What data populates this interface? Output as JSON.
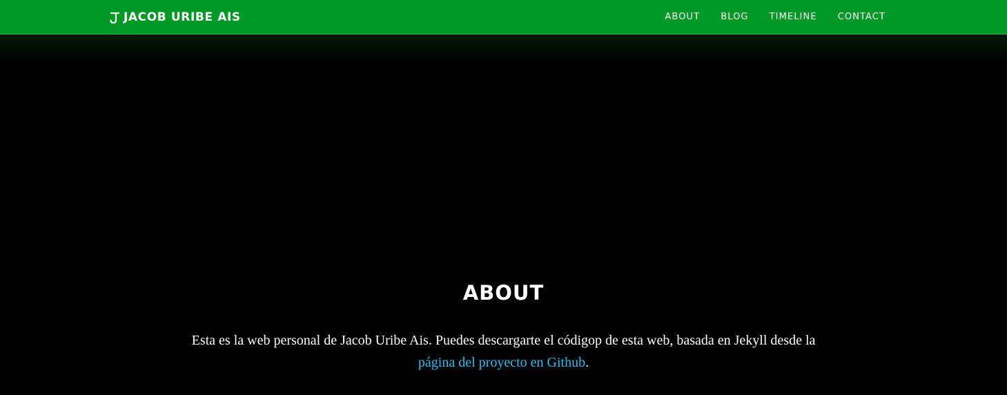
{
  "header": {
    "logo_icon": "jacob-monogram-icon",
    "brand_name": "JACOB URIBE AIS",
    "nav": [
      {
        "label": "ABOUT"
      },
      {
        "label": "BLOG"
      },
      {
        "label": "TIMELINE"
      },
      {
        "label": "CONTACT"
      }
    ]
  },
  "about": {
    "title": "ABOUT",
    "text_before": "Esta es la web personal de Jacob Uribe Ais. Puedes descargarte el códigop de esta web, basada en Jekyll desde la ",
    "link_text": "página del proyecto en Github",
    "text_after": "."
  },
  "colors": {
    "navbar": "#009925",
    "background": "#000000",
    "link": "#1ec0f2",
    "text": "#ffffff"
  }
}
